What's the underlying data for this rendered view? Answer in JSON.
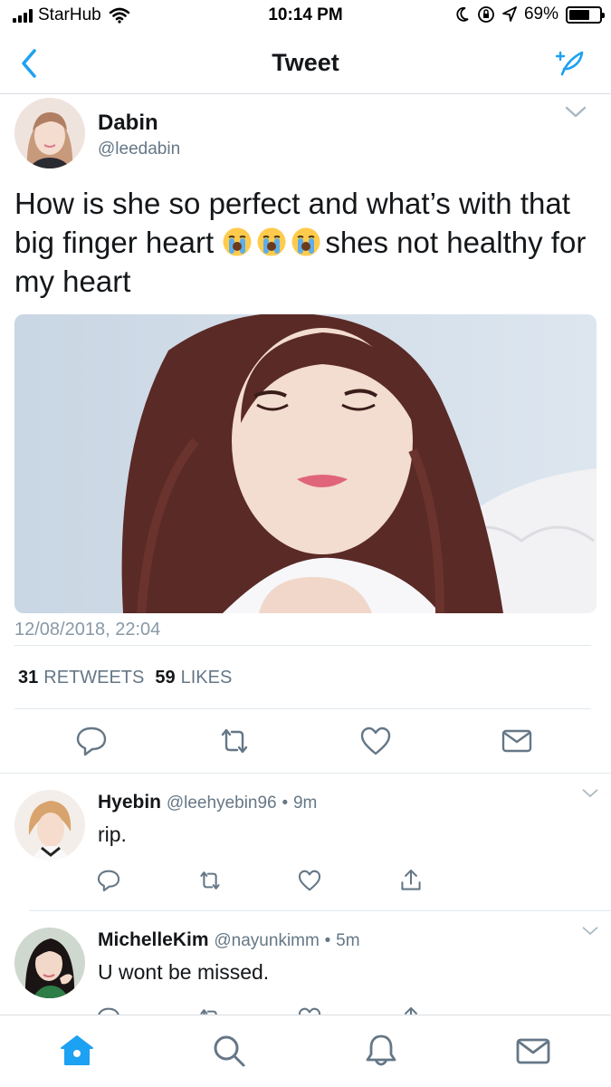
{
  "status_bar": {
    "carrier": "StarHub",
    "time": "10:14 PM",
    "battery_percent": "69%",
    "battery_level": 0.69
  },
  "nav": {
    "title": "Tweet",
    "back_icon": "chevron-left-icon",
    "compose_icon": "compose-feather-icon"
  },
  "tweet": {
    "author_name": "Dabin",
    "author_handle": "@leedabin",
    "text_part1": "How is she so perfect and what’s with that big finger heart ",
    "emoji": "loudly-crying-face",
    "text_part2": "shes not healthy for my heart",
    "date": "12/08/2018, 22:04",
    "retweets_count": "31",
    "retweets_label": "RETWEETS",
    "likes_count": "59",
    "likes_label": "LIKES"
  },
  "replies": [
    {
      "name": "Hyebin",
      "handle": "@leehyebin96",
      "separator": "•",
      "time": "9m",
      "text": "rip."
    },
    {
      "name": "MichelleKim",
      "handle": "@nayunkimm",
      "separator": "•",
      "time": "5m",
      "text": "U wont be missed."
    }
  ],
  "colors": {
    "accent": "#1da1f2",
    "secondary_text": "#657786",
    "icon_gray": "#657786",
    "divider": "#e1e8ed"
  }
}
